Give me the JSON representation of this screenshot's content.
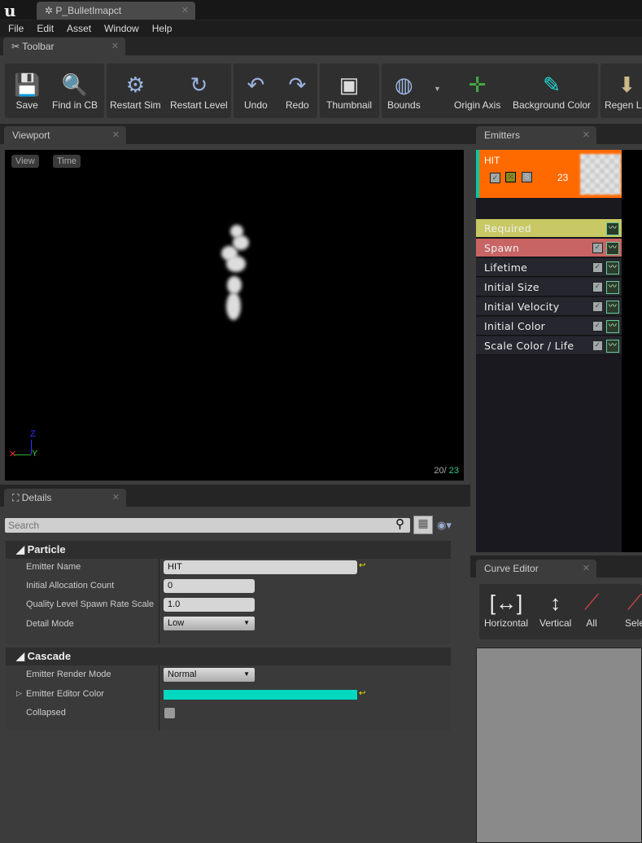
{
  "window": {
    "doc_tab": "P_BulletImapct"
  },
  "menu": [
    "File",
    "Edit",
    "Asset",
    "Window",
    "Help"
  ],
  "toolbar": {
    "tab": "Toolbar",
    "buttons": [
      {
        "label": "Save",
        "icon": "save-icon"
      },
      {
        "label": "Find in CB",
        "icon": "magnifier-icon"
      },
      {
        "label": "Restart Sim",
        "icon": "gear-icon"
      },
      {
        "label": "Restart Level",
        "icon": "restart-icon"
      },
      {
        "label": "Undo",
        "icon": "undo-icon"
      },
      {
        "label": "Redo",
        "icon": "redo-icon"
      },
      {
        "label": "Thumbnail",
        "icon": "thumbnail-icon"
      },
      {
        "label": "Bounds",
        "icon": "bounds-icon"
      },
      {
        "label": "Origin Axis",
        "icon": "axis-icon"
      },
      {
        "label": "Background Color",
        "icon": "eyedropper-icon"
      },
      {
        "label": "Regen LO",
        "icon": "regen-lod-icon"
      }
    ]
  },
  "viewport": {
    "tab": "Viewport",
    "view": "View",
    "time": "Time",
    "axis_z": "Z",
    "axis_y": "Y",
    "count_a": "20/",
    "count_b": "23"
  },
  "emitters": {
    "tab": "Emitters",
    "name": "HIT",
    "count": "23",
    "solo": "S",
    "accent": "#00c8a8",
    "header_color": "#ff6a00",
    "modules": [
      {
        "label": "Required",
        "color": "#c8c864"
      },
      {
        "label": "Spawn",
        "color": "#c86464"
      },
      {
        "label": "Lifetime"
      },
      {
        "label": "Initial Size"
      },
      {
        "label": "Initial Velocity"
      },
      {
        "label": "Initial Color"
      },
      {
        "label": "Scale Color / Life"
      }
    ]
  },
  "details": {
    "tab": "Details",
    "search_placeholder": "Search",
    "particle": {
      "title": "Particle",
      "emitter_name_label": "Emitter Name",
      "emitter_name": "HIT",
      "alloc_label": "Initial Allocation Count",
      "alloc": "0",
      "quality_label": "Quality Level Spawn Rate Scale",
      "quality": "1.0",
      "detail_label": "Detail Mode",
      "detail": "Low"
    },
    "cascade": {
      "title": "Cascade",
      "render_label": "Emitter Render Mode",
      "render": "Normal",
      "color_label": "Emitter Editor Color",
      "color": "#00d8c0",
      "collapsed_label": "Collapsed",
      "collapsed": false
    }
  },
  "curve": {
    "tab": "Curve Editor",
    "buttons": [
      "Horizontal",
      "Vertical",
      "All",
      "Sele"
    ]
  }
}
